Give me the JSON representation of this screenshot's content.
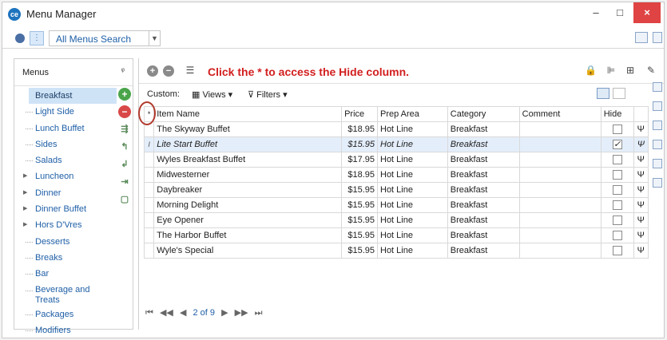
{
  "window": {
    "title": "Menu Manager",
    "minimize": "–",
    "maximize": "□",
    "close": "×"
  },
  "search": {
    "mode_label": "All Menus Search"
  },
  "menus_panel": {
    "header": "Menus",
    "items": [
      {
        "label": "Breakfast",
        "selected": true
      },
      {
        "label": "Light Side"
      },
      {
        "label": "Lunch Buffet"
      },
      {
        "label": "Sides"
      },
      {
        "label": "Salads"
      },
      {
        "label": "Luncheon",
        "expandable": true
      },
      {
        "label": "Dinner",
        "expandable": true
      },
      {
        "label": "Dinner Buffet",
        "expandable": true
      },
      {
        "label": "Hors D'Vres",
        "expandable": true
      },
      {
        "label": "Desserts"
      },
      {
        "label": "Breaks"
      },
      {
        "label": "Bar"
      },
      {
        "label": "Beverage and Treats"
      },
      {
        "label": "Packages"
      },
      {
        "label": "Modifiers"
      }
    ]
  },
  "toolbar": {
    "hint": "Click the * to access the Hide column.",
    "custom_label": "Custom:",
    "views_label": "Views",
    "filters_label": "Filters"
  },
  "grid": {
    "columns": [
      "*",
      "Item Name",
      "Price",
      "Prep Area",
      "Category",
      "Comment",
      "Hide",
      ""
    ],
    "rows": [
      {
        "name": "The Skyway Buffet",
        "price": "$18.95",
        "prep": "Hot Line",
        "category": "Breakfast",
        "comment": "",
        "hide": false
      },
      {
        "name": "Lite Start Buffet",
        "price": "$15.95",
        "prep": "Hot Line",
        "category": "Breakfast",
        "comment": "",
        "hide": true,
        "selected": true
      },
      {
        "name": "Wyles Breakfast Buffet",
        "price": "$17.95",
        "prep": "Hot Line",
        "category": "Breakfast",
        "comment": "",
        "hide": false
      },
      {
        "name": "Midwesterner",
        "price": "$18.95",
        "prep": "Hot Line",
        "category": "Breakfast",
        "comment": "",
        "hide": false
      },
      {
        "name": "Daybreaker",
        "price": "$15.95",
        "prep": "Hot Line",
        "category": "Breakfast",
        "comment": "",
        "hide": false
      },
      {
        "name": "Morning Delight",
        "price": "$15.95",
        "prep": "Hot Line",
        "category": "Breakfast",
        "comment": "",
        "hide": false
      },
      {
        "name": "Eye Opener",
        "price": "$15.95",
        "prep": "Hot Line",
        "category": "Breakfast",
        "comment": "",
        "hide": false
      },
      {
        "name": "The Harbor Buffet",
        "price": "$15.95",
        "prep": "Hot Line",
        "category": "Breakfast",
        "comment": "",
        "hide": false
      },
      {
        "name": "Wyle's Special",
        "price": "$15.95",
        "prep": "Hot Line",
        "category": "Breakfast",
        "comment": "",
        "hide": false
      }
    ]
  },
  "pager": {
    "first": "⏮",
    "prev_page": "◀◀",
    "prev": "◀",
    "position": "2 of 9",
    "next": "▶",
    "next_page": "▶▶",
    "last": "⏭"
  }
}
